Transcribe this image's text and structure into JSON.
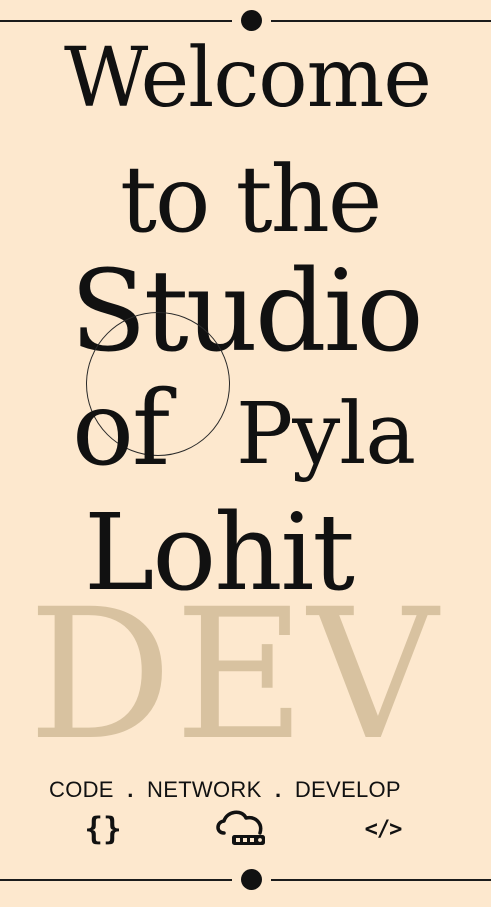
{
  "hero": {
    "line_1": "Welcome",
    "line_2": "to the",
    "line_3": "Studio",
    "line_4a": "of",
    "line_4b": "Pyla",
    "line_5": "Lohit",
    "watermark": "DEV"
  },
  "tagline": {
    "item_1": "CODE",
    "separator_1": ".",
    "item_2": "NETWORK",
    "separator_2": ".",
    "item_3": "DEVELOP"
  },
  "icons": [
    {
      "semantic": "code-braces-icon",
      "glyph": "{}"
    },
    {
      "semantic": "cloud-server-icon"
    },
    {
      "semantic": "code-tag-icon",
      "glyph": "</>"
    }
  ],
  "colors": {
    "background": "#FDE8CE",
    "text": "#111111",
    "watermark": "#D8C2A0"
  }
}
